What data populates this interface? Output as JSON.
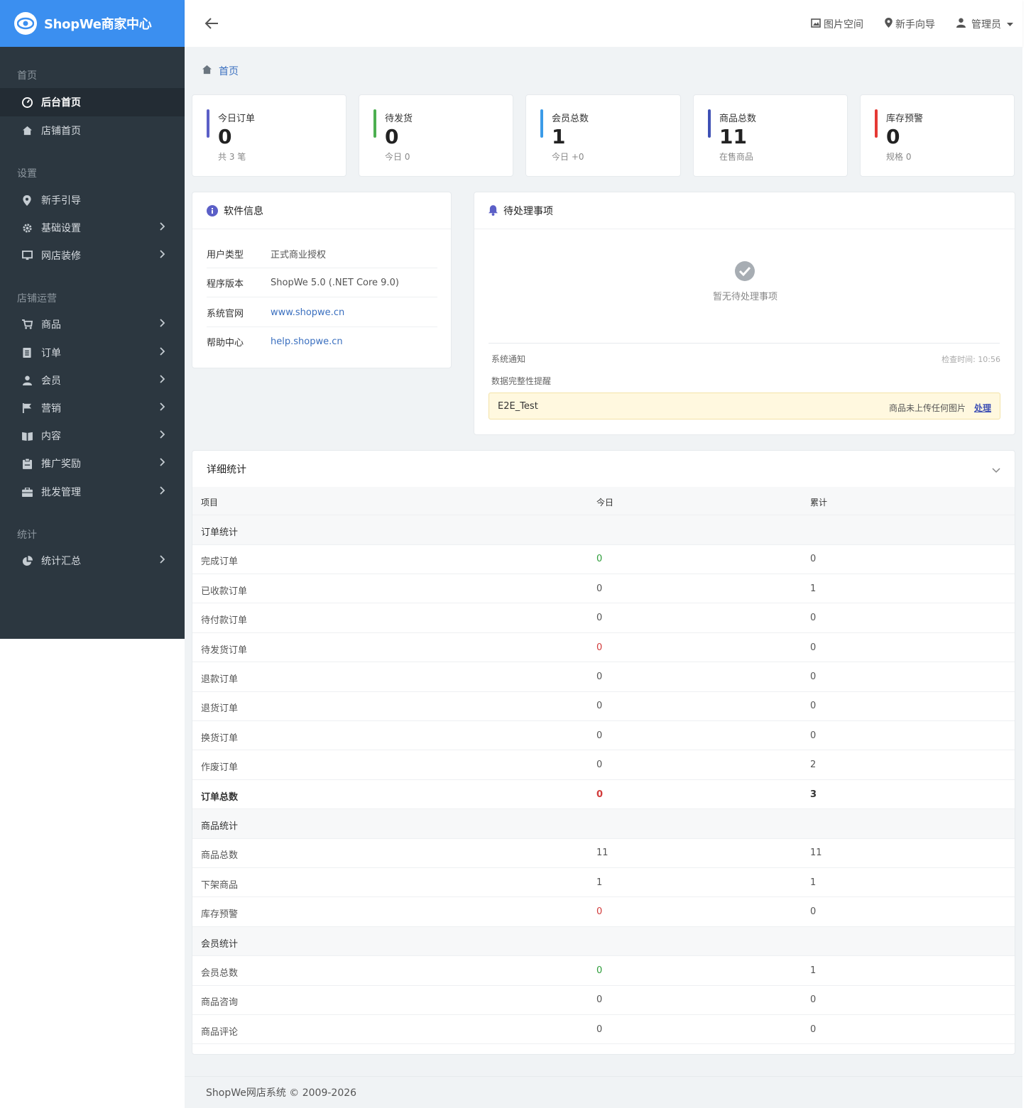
{
  "brand": {
    "name": "ShopWe商家中心"
  },
  "topbar": {
    "image_space": "图片空间",
    "guide": "新手向导",
    "user": "管理员"
  },
  "sidebar": {
    "groups": [
      "首页",
      "设置",
      "店铺运营",
      "统计"
    ],
    "items": [
      {
        "label": "后台首页",
        "icon": "dashboard-icon"
      },
      {
        "label": "店铺首页",
        "icon": "home-icon"
      },
      {
        "label": "新手引导",
        "icon": "map-marker-icon"
      },
      {
        "label": "基础设置",
        "icon": "gear-icon"
      },
      {
        "label": "网店装修",
        "icon": "monitor-icon"
      },
      {
        "label": "商品",
        "icon": "cart-icon"
      },
      {
        "label": "订单",
        "icon": "list-icon"
      },
      {
        "label": "会员",
        "icon": "user-icon"
      },
      {
        "label": "营销",
        "icon": "flag-icon"
      },
      {
        "label": "内容",
        "icon": "book-icon"
      },
      {
        "label": "推广奖励",
        "icon": "badge-icon"
      },
      {
        "label": "批发管理",
        "icon": "briefcase-icon"
      },
      {
        "label": "统计汇总",
        "icon": "pie-chart-icon"
      }
    ]
  },
  "breadcrumb": {
    "home": "首页"
  },
  "stats": [
    {
      "label": "今日订单",
      "value": "0",
      "sub": "共 3 笔",
      "color": "#5b5fc7"
    },
    {
      "label": "待发货",
      "value": "0",
      "sub": "今日 0",
      "color": "#4caf50"
    },
    {
      "label": "会员总数",
      "value": "1",
      "sub": "今日 +0",
      "color": "#3b9be8"
    },
    {
      "label": "商品总数",
      "value": "11",
      "sub": "在售商品",
      "color": "#3f51b5"
    },
    {
      "label": "库存预警",
      "value": "0",
      "sub": "规格 0",
      "color": "#e53935"
    }
  ],
  "software": {
    "title": "软件信息",
    "rows": [
      {
        "k": "用户类型",
        "v": "正式商业授权"
      },
      {
        "k": "程序版本",
        "v": "ShopWe 5.0 (.NET Core 9.0)"
      },
      {
        "k": "系统官网",
        "v": "www.shopwe.cn"
      },
      {
        "k": "帮助中心",
        "v": "help.shopwe.cn"
      }
    ]
  },
  "pending": {
    "title": "待处理事项",
    "empty": "暂无待处理事项",
    "notice_label": "系统通知",
    "check_time": "检查时间: 10:56",
    "integrity": "数据完整性提醒",
    "alert_name": "E2E_Test",
    "alert_msg": "商品未上传任何图片",
    "alert_action": "处理"
  },
  "detail": {
    "title": "详细统计",
    "headers": [
      "项目",
      "今日",
      "累计"
    ],
    "rows": [
      {
        "type": "group",
        "label": "订单统计"
      },
      {
        "label": "完成订单",
        "today": "0",
        "total": "0",
        "today_color": "green"
      },
      {
        "label": "已收款订单",
        "today": "0",
        "total": "1"
      },
      {
        "label": "待付款订单",
        "today": "0",
        "total": "0"
      },
      {
        "label": "待发货订单",
        "today": "0",
        "total": "0",
        "today_color": "red"
      },
      {
        "label": "退款订单",
        "today": "0",
        "total": "0"
      },
      {
        "label": "退货订单",
        "today": "0",
        "total": "0"
      },
      {
        "label": "换货订单",
        "today": "0",
        "total": "0"
      },
      {
        "label": "作废订单",
        "today": "0",
        "total": "2"
      },
      {
        "type": "bold",
        "label": "订单总数",
        "today": "0",
        "total": "3",
        "today_color": "red"
      },
      {
        "type": "group",
        "label": "商品统计"
      },
      {
        "label": "商品总数",
        "today": "11",
        "total": "11"
      },
      {
        "label": "下架商品",
        "today": "1",
        "total": "1"
      },
      {
        "label": "库存预警",
        "today": "0",
        "total": "0",
        "today_color": "red"
      },
      {
        "type": "group",
        "label": "会员统计"
      },
      {
        "label": "会员总数",
        "today": "0",
        "total": "1",
        "today_color": "green"
      },
      {
        "label": "商品咨询",
        "today": "0",
        "total": "0"
      },
      {
        "label": "商品评论",
        "today": "0",
        "total": "0"
      }
    ]
  },
  "footer": {
    "text": "ShopWe网店系统 © 2009-2026"
  }
}
